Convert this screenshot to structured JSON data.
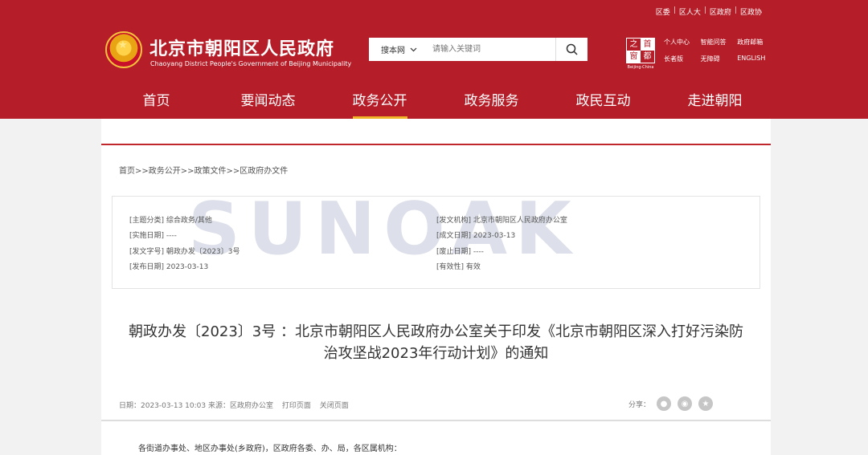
{
  "header": {
    "top_links": [
      "区委",
      "区人大",
      "区政府",
      "区政协"
    ],
    "logo_cn": "北京市朝阳区人民政府",
    "logo_en": "Chaoyang District People's Government of Beijing Municipality",
    "search": {
      "scope": "搜本网",
      "placeholder": "请输入关键词"
    },
    "shoudu": {
      "chars": [
        "之",
        "首",
        "都",
        "窗"
      ],
      "en": "Beijing·China"
    },
    "quick_links": [
      "个人中心",
      "智能问答",
      "政府邮箱",
      "长者版",
      "无障碍",
      "ENGLISH"
    ],
    "nav": [
      "首页",
      "要闻动态",
      "政务公开",
      "政务服务",
      "政民互动",
      "走进朝阳"
    ],
    "active_nav": "政务公开"
  },
  "breadcrumb": "首页>>政务公开>>政策文件>>区政府办文件",
  "watermark": "SUNOAK",
  "meta": {
    "topic": "[主题分类] 综合政务/其他",
    "effective_date": "[实施日期] ----",
    "doc_number": "[发文字号] 朝政办发〔2023〕3号",
    "publish_date": "[发布日期] 2023-03-13",
    "issuer": "[发文机构] 北京市朝阳区人民政府办公室",
    "written_date": "[成文日期] 2023-03-13",
    "abolish_date": "[废止日期] ----",
    "validity": "[有效性] 有效"
  },
  "title_line1": "朝政办发〔2023〕3号 ：北京市朝阳区人民政府办公室关于印发《北京市朝阳区深入打好污染防",
  "title_line2": "治攻坚战2023年行动计划》的通知",
  "info": {
    "date_source": "日期：2023-03-13 10:03 来源：区政府办公室",
    "print": "打印页面",
    "close": "关闭页面",
    "share_label": "分享："
  },
  "body_first_line": "各街道办事处、地区办事处(乡政府)，区政府各委、办、局，各区属机构："
}
